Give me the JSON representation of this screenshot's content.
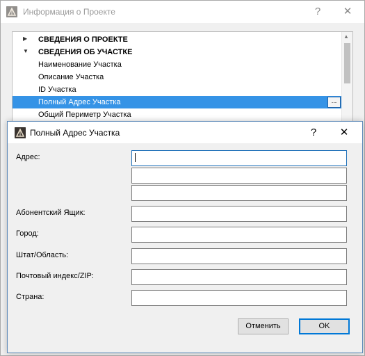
{
  "background_window": {
    "title": "Информация о Проекте",
    "help_label": "?",
    "close_label": "✕",
    "tree": {
      "rows": [
        {
          "label": "СВЕДЕНИЯ О ПРОЕКТЕ",
          "arrow": "▶"
        },
        {
          "label": "СВЕДЕНИЯ ОБ УЧАСТКЕ",
          "arrow": "▼"
        },
        {
          "label": "Наименование Участка"
        },
        {
          "label": "Описание Участка"
        },
        {
          "label": "ID Участка"
        },
        {
          "label": "Полный Адрес Участка"
        },
        {
          "label": "Общий Периметр Участка"
        }
      ],
      "ellipsis_label": "...",
      "scroll_up": "▲"
    }
  },
  "dialog": {
    "title": "Полный Адрес Участка",
    "help_label": "?",
    "close_label": "✕",
    "fields": {
      "address_label": "Адрес:",
      "address_line1": "",
      "address_line2": "",
      "address_line3": "",
      "po_box_label": "Абонентский Ящик:",
      "po_box": "",
      "city_label": "Город:",
      "city": "",
      "state_label": "Штат/Область:",
      "state": "",
      "zip_label": "Почтовый индекс/ZIP:",
      "zip": "",
      "country_label": "Страна:",
      "country": ""
    },
    "cancel_label": "Отменить",
    "ok_label": "OK"
  },
  "colors": {
    "selection": "#3593e6",
    "focus_border": "#1e6fb8",
    "default_button_border": "#0078d7"
  }
}
